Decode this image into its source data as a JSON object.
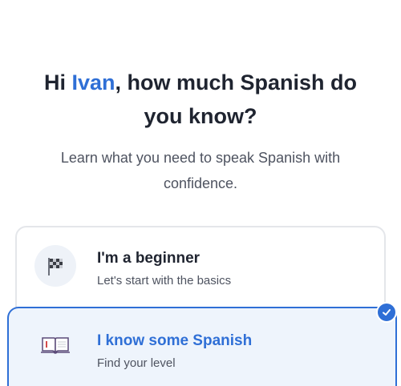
{
  "heading": {
    "greeting": "Hi ",
    "name": "Ivan",
    "rest_line1": ", how much Spanish do",
    "rest_line2": "you know?"
  },
  "subtitle": "Learn what you need to speak Spanish with confidence.",
  "options": [
    {
      "title": "I'm a beginner",
      "subtitle": "Let's start with the basics",
      "icon": "checkered-flag-icon",
      "selected": false
    },
    {
      "title": "I know some Spanish",
      "subtitle": "Find your level",
      "icon": "open-book-icon",
      "selected": true
    }
  ],
  "colors": {
    "accent": "#2f6fd6",
    "text": "#1f2430",
    "muted": "#4e5360",
    "selected_bg": "#eef4fc"
  }
}
